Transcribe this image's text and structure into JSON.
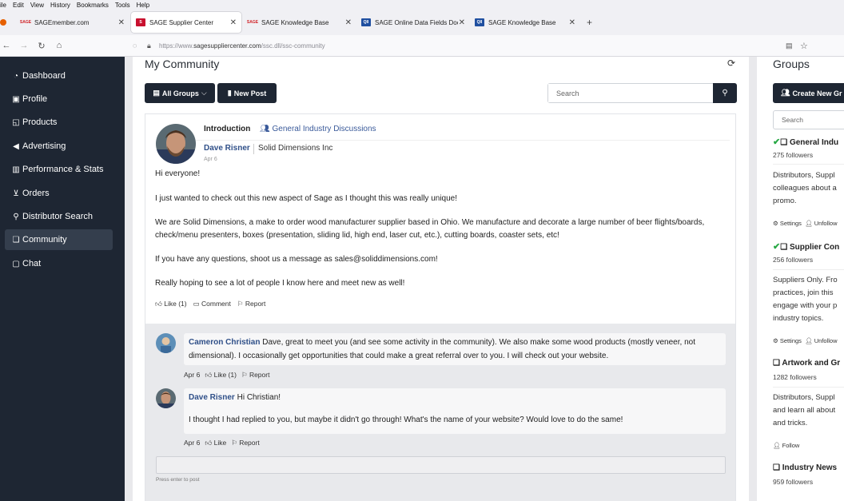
{
  "browser": {
    "menu": [
      "ile",
      "Edit",
      "View",
      "History",
      "Bookmarks",
      "Tools",
      "Help"
    ],
    "tabs": [
      {
        "favicon": "SAGE",
        "label": "SAGEmember.com"
      },
      {
        "favicon": "S",
        "label": "SAGE Supplier Center"
      },
      {
        "favicon": "SAGE",
        "label": "SAGE Knowledge Base"
      },
      {
        "favicon": "QII",
        "label": "SAGE Online Data Fields Docum"
      },
      {
        "favicon": "QII",
        "label": "SAGE Knowledge Base"
      }
    ],
    "url_prefix": "https://www.",
    "url_host": "sagesuppliercenter.com",
    "url_path": "/ssc.dll/ssc-community"
  },
  "sidebar": {
    "items": [
      {
        "icon": "dashboard-icon",
        "label": "Dashboard"
      },
      {
        "icon": "profile-icon",
        "label": "Profile"
      },
      {
        "icon": "products-icon",
        "label": "Products"
      },
      {
        "icon": "megaphone-icon",
        "label": "Advertising"
      },
      {
        "icon": "chart-icon",
        "label": "Performance & Stats"
      },
      {
        "icon": "cart-icon",
        "label": "Orders"
      },
      {
        "icon": "search-icon",
        "label": "Distributor Search"
      },
      {
        "icon": "chat-bubbles-icon",
        "label": "Community"
      },
      {
        "icon": "chat-icon",
        "label": "Chat"
      }
    ]
  },
  "main": {
    "title": "My Community",
    "all_groups_label": "All Groups",
    "new_post_label": "New Post",
    "search_placeholder": "Search",
    "post": {
      "type": "Introduction",
      "group": "General Industry Discussions",
      "author": "Dave Risner",
      "company": "Solid Dimensions Inc",
      "date": "Apr 6",
      "paragraphs": [
        "Hi everyone!",
        "I just wanted to check out this new aspect of Sage as I thought this was really unique!",
        "We are Solid Dimensions, a make to order wood manufacturer supplier based in Ohio. We manufacture and decorate a large number of beer flights/boards, check/menu presenters, boxes (presentation, sliding lid, high end, laser cut, etc.), cutting boards, coaster sets, etc!",
        "If you have any questions, shoot us a message as sales@soliddimensions.com!",
        "Really hoping to see a lot of people I know here and meet new as well!"
      ],
      "like_label": "Like (1)",
      "comment_label": "Comment",
      "report_label": "Report"
    },
    "comments": [
      {
        "author": "Cameron Christian",
        "text": "Dave, great to meet you (and see some activity in the community). We also make some wood products (mostly veneer, not dimensional). I occasionally get opportunities that could make a great referral over to you. I will check out your website.",
        "date": "Apr 6",
        "like_label": "Like (1)",
        "report_label": "Report"
      },
      {
        "author": "Dave Risner",
        "text_line1": "Hi Christian!",
        "text_line2": "I thought I had replied to you, but maybe it didn't go through! What's the name of your website? Would love to do the same!",
        "date": "Apr 6",
        "like_label": "Like",
        "report_label": "Report"
      }
    ],
    "reply_hint": "Press enter to post"
  },
  "groups": {
    "title": "Groups",
    "create_label": "Create New Gr",
    "search_placeholder": "Search",
    "settings_label": "Settings",
    "unfollow_label": "Unfollow",
    "follow_label": "Follow",
    "items": [
      {
        "name": "General Indu",
        "followers": "275 followers",
        "desc": "Distributors, Suppl\ncolleagues about a\npromo."
      },
      {
        "name": "Supplier Con",
        "followers": "256 followers",
        "desc": "Suppliers Only. Fro\npractices, join this\nengage with your p\nindustry topics."
      },
      {
        "name": "Artwork and Gr",
        "followers": "1282 followers",
        "desc": "Distributors, Suppl\nand learn all about\nand tricks."
      },
      {
        "name": "Industry News",
        "followers": "959 followers"
      }
    ]
  }
}
